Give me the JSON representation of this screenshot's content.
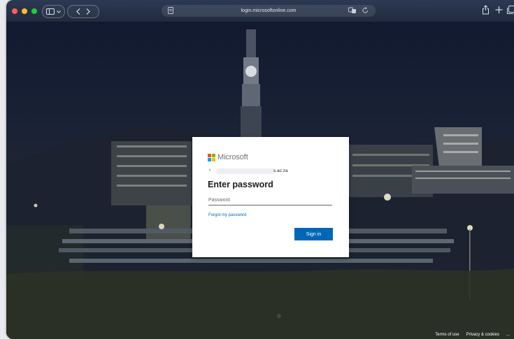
{
  "browser": {
    "url": "login.microsoftonline.com",
    "icons": [
      "sidebar-icon",
      "chevron-down-icon",
      "back-icon",
      "forward-icon",
      "page-icon",
      "translate-icon",
      "reload-icon",
      "share-icon",
      "plus-icon",
      "tabs-icon"
    ]
  },
  "signin": {
    "brand": "Microsoft",
    "identity_suffix": "s.ac.za",
    "title": "Enter password",
    "password_placeholder": "Password",
    "forgot_link": "Forgot my password",
    "submit_label": "Sign in",
    "brand_colors": [
      "#f25022",
      "#7fba00",
      "#00a4ef",
      "#ffb900"
    ],
    "accent": "#0067b8"
  },
  "footer": {
    "terms": "Terms of use",
    "privacy": "Privacy & cookies",
    "more": "..."
  }
}
